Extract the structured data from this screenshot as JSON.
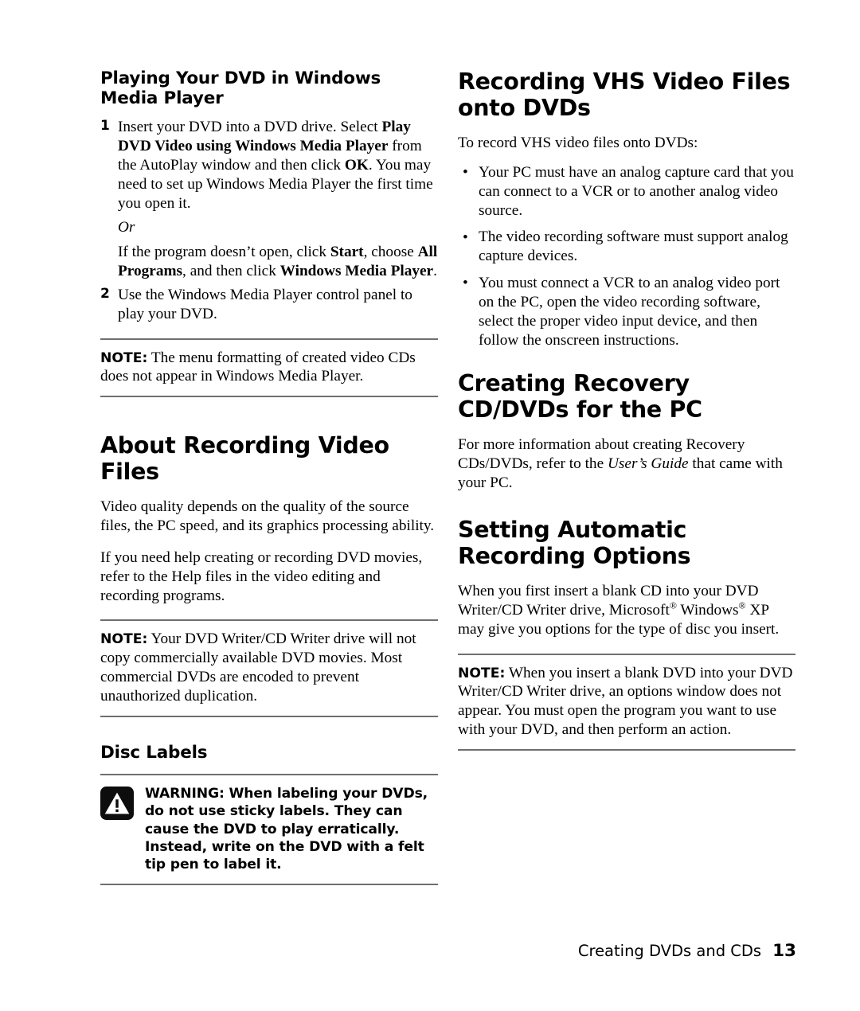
{
  "page": {
    "footer_text": "Creating DVDs and CDs",
    "page_number": "13",
    "rule_color": "#6f6f6f"
  },
  "left_column": {
    "heading_playing": "Playing Your DVD in Windows Media Player",
    "steps": [
      {
        "number": "1",
        "text_1": "Insert your DVD into a DVD drive. Select ",
        "bold_1": "Play DVD Video using Windows Media Player",
        "text_2": " from the AutoPlay window and then click ",
        "bold_2": "OK",
        "text_3": ". You may need to set up Windows Media Player the first time you open it.",
        "or_label": "Or",
        "alt_text_1": "If the program doesn’t open, click ",
        "alt_bold_1": "Start",
        "alt_text_2": ", choose ",
        "alt_bold_2": "All Programs",
        "alt_text_3": ", and then click ",
        "alt_bold_3": "Windows Media Player",
        "alt_text_4": "."
      },
      {
        "number": "2",
        "text_1": "Use the Windows Media Player control panel to play your DVD."
      }
    ],
    "note_1": {
      "label": "NOTE:",
      "text": " The menu formatting of created video CDs does not appear in Windows Media Player."
    },
    "heading_about": "About Recording Video Files",
    "para_quality": "Video quality depends on the quality of the source files, the PC speed, and its graphics processing ability.",
    "para_help": "If you need help creating or recording DVD movies, refer to the Help files in the video editing and recording programs.",
    "note_2": {
      "label": "NOTE:",
      "text": " Your DVD Writer/CD Writer drive will not copy commercially available DVD movies. Most commercial DVDs are encoded to prevent unauthorized duplication."
    },
    "heading_disc_labels": "Disc Labels",
    "warning": {
      "icon": "warning-triangle-icon",
      "text": "WARNING: When labeling your DVDs, do not use sticky labels. They can cause the DVD to play erratically. Instead, write on the DVD with a felt tip pen to label it."
    }
  },
  "right_column": {
    "heading_vhs": "Recording VHS Video Files onto DVDs",
    "vhs_intro": "To record VHS video files onto DVDs:",
    "vhs_bullets": [
      "Your PC must have an analog capture card that you can connect to a VCR or to another analog video source.",
      "The video recording software must support analog capture devices.",
      "You must connect a VCR to an analog video port on the PC, open the video recording software, select the proper video input device, and then follow the onscreen instructions."
    ],
    "heading_recovery": "Creating Recovery CD/DVDs for the PC",
    "recovery_text_1": "For more information about creating Recovery CDs/DVDs, refer to the ",
    "recovery_italic": "User’s Guide",
    "recovery_text_2": " that came with your PC.",
    "heading_auto": "Setting Automatic Recording Options",
    "auto_text_1": "When you first insert a blank CD into your DVD Writer/CD Writer drive, Microsoft",
    "auto_reg_1": "®",
    "auto_text_2": " Windows",
    "auto_reg_2": "®",
    "auto_text_3": " XP may give you options for the type of disc you insert.",
    "note_3": {
      "label": "NOTE:",
      "text": " When you insert a blank DVD into your DVD Writer/CD Writer drive, an options window does not appear. You must open the program you want to use with your DVD, and then perform an action."
    }
  }
}
